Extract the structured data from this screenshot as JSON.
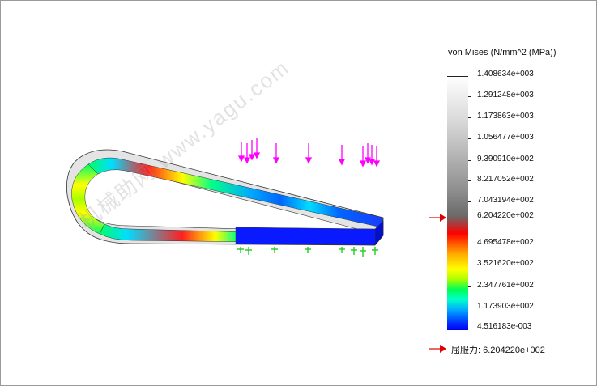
{
  "legend": {
    "title": "von Mises (N/mm^2 (MPa))",
    "ticks": [
      "1.408634e+003",
      "1.291248e+003",
      "1.173863e+003",
      "1.056477e+003",
      "9.390910e+002",
      "8.217052e+002",
      "7.043194e+002",
      "6.204220e+002",
      "4.695478e+002",
      "3.521620e+002",
      "2.347761e+002",
      "1.173903e+002",
      "4.516183e-003"
    ]
  },
  "yield": {
    "label": "屈服力: 6.204220e+002"
  },
  "watermark": {
    "text": "机械助网 www.yagu.com"
  },
  "colors": {
    "load_arrows": "#ff00ff",
    "fixtures": "#22cc22",
    "yield_marker": "#e00000"
  },
  "icons": {
    "load": "arrow-down-icon",
    "fixture": "fixture-icon",
    "yield_marker": "arrow-right-icon"
  }
}
